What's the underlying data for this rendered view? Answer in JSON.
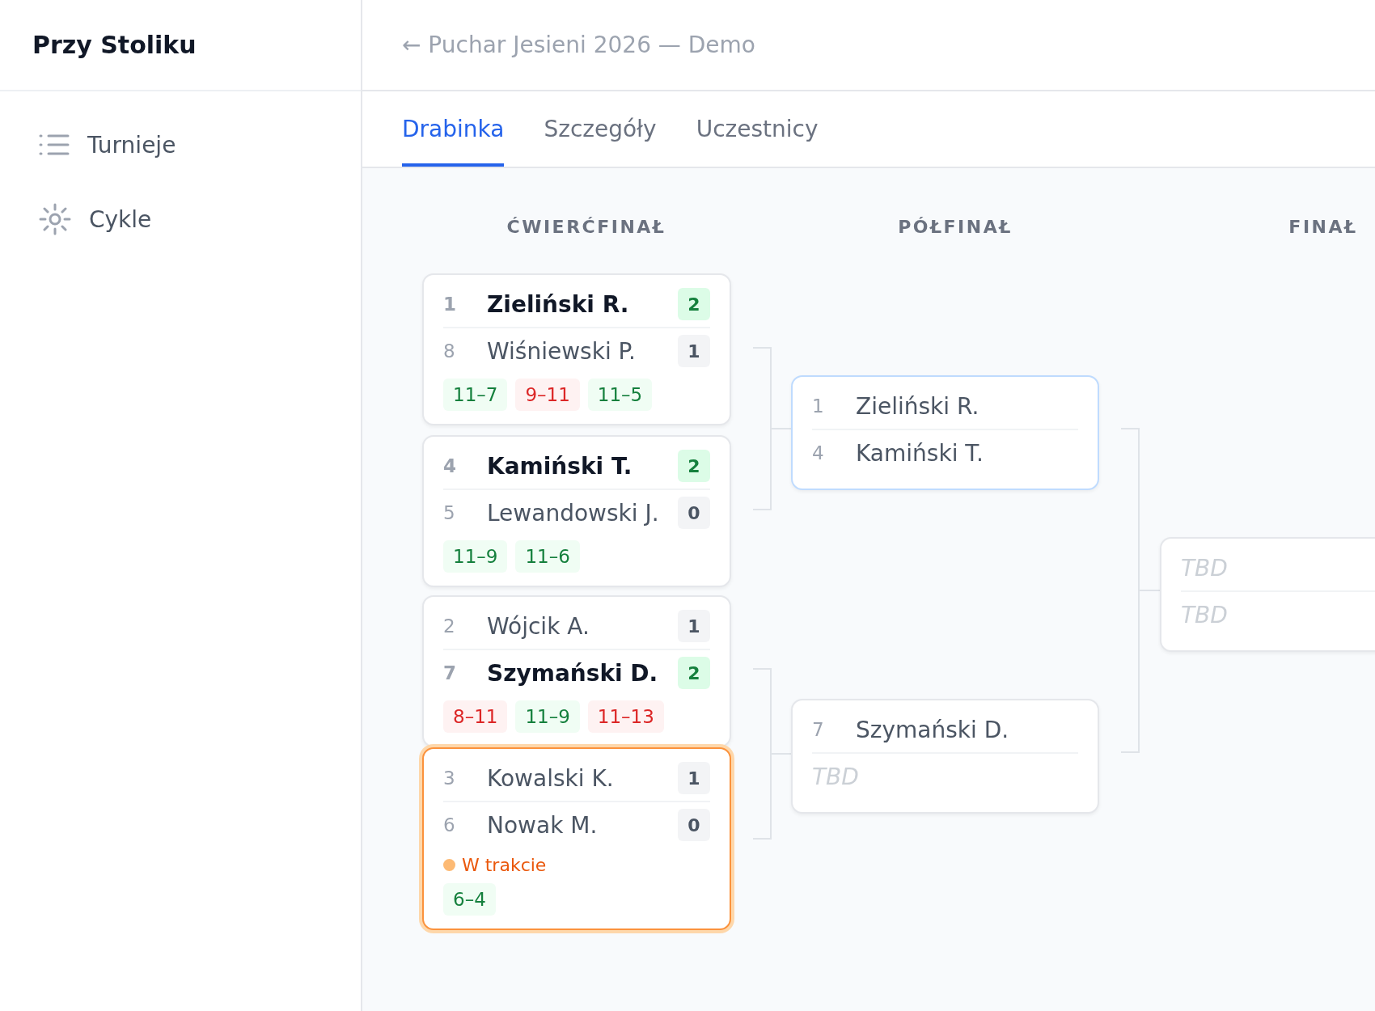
{
  "sidebar": {
    "brand": "Przy Stoliku",
    "items": [
      {
        "label": "Turnieje",
        "selected": false
      },
      {
        "label": "Cykle",
        "selected": false
      }
    ]
  },
  "header": {
    "back_link": "← Puchar Jesieni 2026 — Demo"
  },
  "tabs": [
    {
      "label": "Drabinka",
      "selected": true
    },
    {
      "label": "Szczegóły",
      "selected": false
    },
    {
      "label": "Uczestnicy",
      "selected": false
    }
  ],
  "rounds": [
    {
      "title": "ĆWIERĆFINAŁ",
      "matches": [
        {
          "highlighted": false,
          "live": false,
          "players": [
            {
              "kind": "player",
              "seed": "1",
              "name": "Zieliński R.",
              "score": "2",
              "winner": true
            },
            {
              "kind": "player",
              "seed": "8",
              "name": "Wiśniewski P.",
              "score": "1",
              "winner": false
            }
          ],
          "sets": [
            {
              "score": "11–7",
              "won": true
            },
            {
              "score": "9–11",
              "won": false
            },
            {
              "score": "11–5",
              "won": true
            }
          ]
        },
        {
          "highlighted": false,
          "live": false,
          "players": [
            {
              "kind": "player",
              "seed": "4",
              "name": "Kamiński T.",
              "score": "2",
              "winner": true
            },
            {
              "kind": "player",
              "seed": "5",
              "name": "Lewandowski J.",
              "score": "0",
              "winner": false
            }
          ],
          "sets": [
            {
              "score": "11–9",
              "won": true
            },
            {
              "score": "11–6",
              "won": true
            }
          ]
        },
        {
          "highlighted": false,
          "live": false,
          "players": [
            {
              "kind": "player",
              "seed": "2",
              "name": "Wójcik A.",
              "score": "1",
              "winner": false
            },
            {
              "kind": "player",
              "seed": "7",
              "name": "Szymański D.",
              "score": "2",
              "winner": true
            }
          ],
          "sets": [
            {
              "score": "8–11",
              "won": false
            },
            {
              "score": "11–9",
              "won": true
            },
            {
              "score": "11–13",
              "won": false
            }
          ]
        },
        {
          "highlighted": false,
          "live": true,
          "status": "W trakcie",
          "players": [
            {
              "kind": "player",
              "seed": "3",
              "name": "Kowalski K.",
              "score": "1",
              "winner": false
            },
            {
              "kind": "player",
              "seed": "6",
              "name": "Nowak M.",
              "score": "0",
              "winner": false
            }
          ],
          "sets": [
            {
              "score": "6–4",
              "won": true
            }
          ]
        }
      ]
    },
    {
      "title": "PÓŁFINAŁ",
      "matches": [
        {
          "highlighted": true,
          "live": false,
          "players": [
            {
              "kind": "player",
              "seed": "1",
              "name": "Zieliński R.",
              "winner": false
            },
            {
              "kind": "player",
              "seed": "4",
              "name": "Kamiński T.",
              "winner": false
            }
          ]
        },
        {
          "highlighted": false,
          "live": false,
          "players": [
            {
              "kind": "player",
              "seed": "7",
              "name": "Szymański D.",
              "winner": false
            },
            {
              "kind": "tbd",
              "name": "TBD"
            }
          ]
        }
      ]
    },
    {
      "title": "FINAŁ",
      "matches": [
        {
          "highlighted": false,
          "live": false,
          "players": [
            {
              "kind": "tbd",
              "name": "TBD"
            },
            {
              "kind": "tbd",
              "name": "TBD"
            }
          ]
        }
      ]
    }
  ]
}
